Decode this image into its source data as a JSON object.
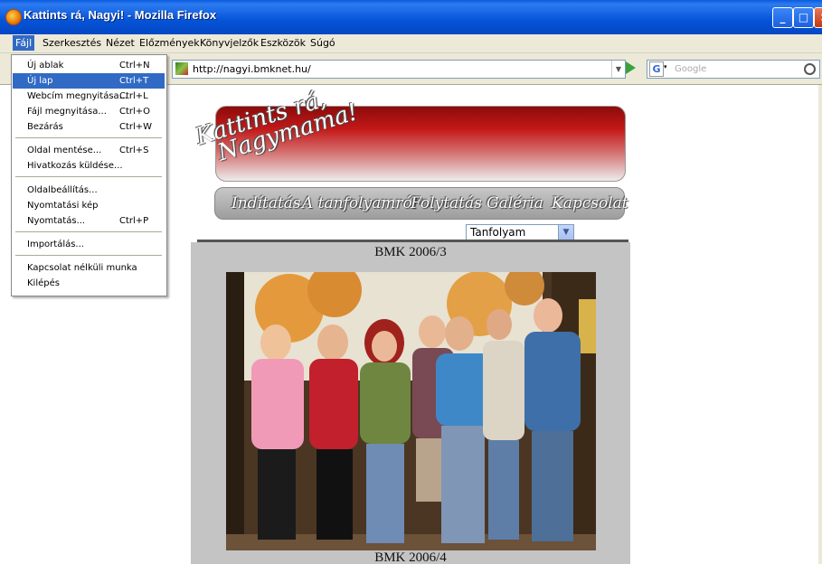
{
  "window": {
    "title": "Kattints rá, Nagyi! - Mozilla Firefox"
  },
  "menubar": [
    "Fájl",
    "Szerkesztés",
    "Nézet",
    "Előzmények",
    "Könyvjelzők",
    "Eszközök",
    "Súgó"
  ],
  "navbar": {
    "url": "http://nagyi.bmknet.hu/",
    "search_placeholder": "Google"
  },
  "file_menu": {
    "items": [
      {
        "label": "Új ablak",
        "shortcut": "Ctrl+N"
      },
      {
        "label": "Új lap",
        "shortcut": "Ctrl+T"
      },
      {
        "label": "Webcím megnyitása...",
        "shortcut": "Ctrl+L"
      },
      {
        "label": "Fájl megnyitása...",
        "shortcut": "Ctrl+O"
      },
      {
        "label": "Bezárás",
        "shortcut": "Ctrl+W"
      },
      {
        "label": "Oldal mentése...",
        "shortcut": "Ctrl+S"
      },
      {
        "label": "Hivatkozás küldése...",
        "shortcut": ""
      },
      {
        "label": "Oldalbeállítás...",
        "shortcut": ""
      },
      {
        "label": "Nyomtatási kép",
        "shortcut": ""
      },
      {
        "label": "Nyomtatás...",
        "shortcut": "Ctrl+P"
      },
      {
        "label": "Importálás...",
        "shortcut": ""
      },
      {
        "label": "Kapcsolat nélküli munka",
        "shortcut": ""
      },
      {
        "label": "Kilépés",
        "shortcut": ""
      }
    ]
  },
  "page": {
    "logo_line1": "Kattints rá,",
    "logo_line2": "Nagymama!",
    "nav": [
      "Indítatás",
      "A tanfolyamról",
      "Folytatás",
      "Galéria",
      "Kapcsolat"
    ],
    "select_value": "Tanfolyam",
    "caption_top": "BMK 2006/3",
    "caption_bottom": "BMK 2006/4"
  },
  "colors": {
    "selection": "#316ac5",
    "titlebar": "#0553d8",
    "banner_red": "#c41818",
    "gallery_bg": "#c4c4c4"
  }
}
